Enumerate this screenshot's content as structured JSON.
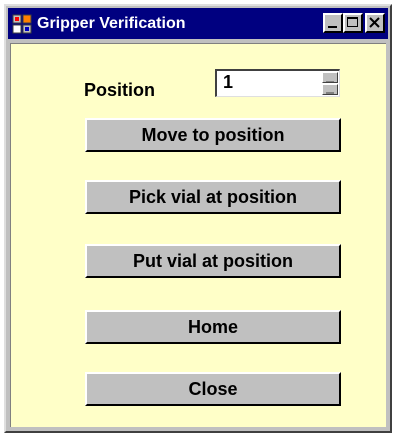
{
  "window": {
    "title": "Gripper Verification",
    "icon": "app-icon",
    "controls": {
      "minimize_icon": "minimize-icon",
      "maximize_icon": "maximize-icon",
      "close_icon": "close-icon"
    }
  },
  "form": {
    "position_label": "Position",
    "position_value": "1"
  },
  "buttons": {
    "move": "Move to position",
    "pick": "Pick vial at position",
    "put": "Put vial at position",
    "home": "Home",
    "close": "Close"
  },
  "colors": {
    "titlebar": "#000080",
    "client_background": "#ffffc8",
    "button_face": "#c0c0c0"
  }
}
